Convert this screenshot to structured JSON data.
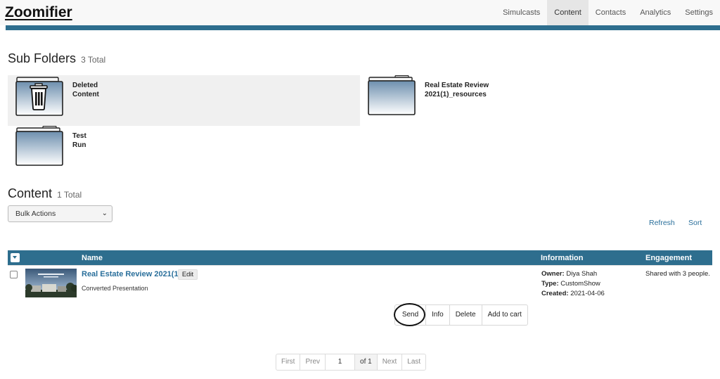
{
  "app": {
    "logo_text": "Zoomifier"
  },
  "nav": {
    "items": [
      {
        "label": "Simulcasts"
      },
      {
        "label": "Content",
        "active": true
      },
      {
        "label": "Contacts"
      },
      {
        "label": "Analytics"
      },
      {
        "label": "Settings"
      }
    ]
  },
  "subfolders": {
    "heading": "Sub Folders",
    "count": "3 Total",
    "items": [
      {
        "name_line1": "Deleted",
        "name_line2": "Content",
        "icon": "trash-folder-icon"
      },
      {
        "name_line1": "Real Estate Review",
        "name_line2": "2021(1)_resources",
        "icon": "folder-icon"
      },
      {
        "name_line1": "Test",
        "name_line2": "Run",
        "icon": "folder-icon"
      }
    ]
  },
  "content": {
    "heading": "Content",
    "count": "1 Total",
    "bulk_actions": "Bulk Actions",
    "refresh": "Refresh",
    "sort": "Sort",
    "columns": {
      "name": "Name",
      "information": "Information",
      "engagement": "Engagement"
    },
    "rows": [
      {
        "title": "Real Estate Review 2021(1)",
        "edit": "Edit",
        "subtitle": "Converted Presentation",
        "owner_label": "Owner:",
        "owner": "Diya Shah",
        "type_label": "Type:",
        "type": "CustomShow",
        "created_label": "Created:",
        "created": "2021-04-06",
        "engagement": "Shared with 3 people.",
        "actions": [
          "Send",
          "Info",
          "Delete",
          "Add to cart"
        ]
      }
    ]
  },
  "pagination": {
    "first": "First",
    "prev": "Prev",
    "page": "1",
    "of": "of 1",
    "next": "Next",
    "last": "Last"
  },
  "colors": {
    "accent": "#2e6e8e",
    "link": "#2a6f9b"
  }
}
